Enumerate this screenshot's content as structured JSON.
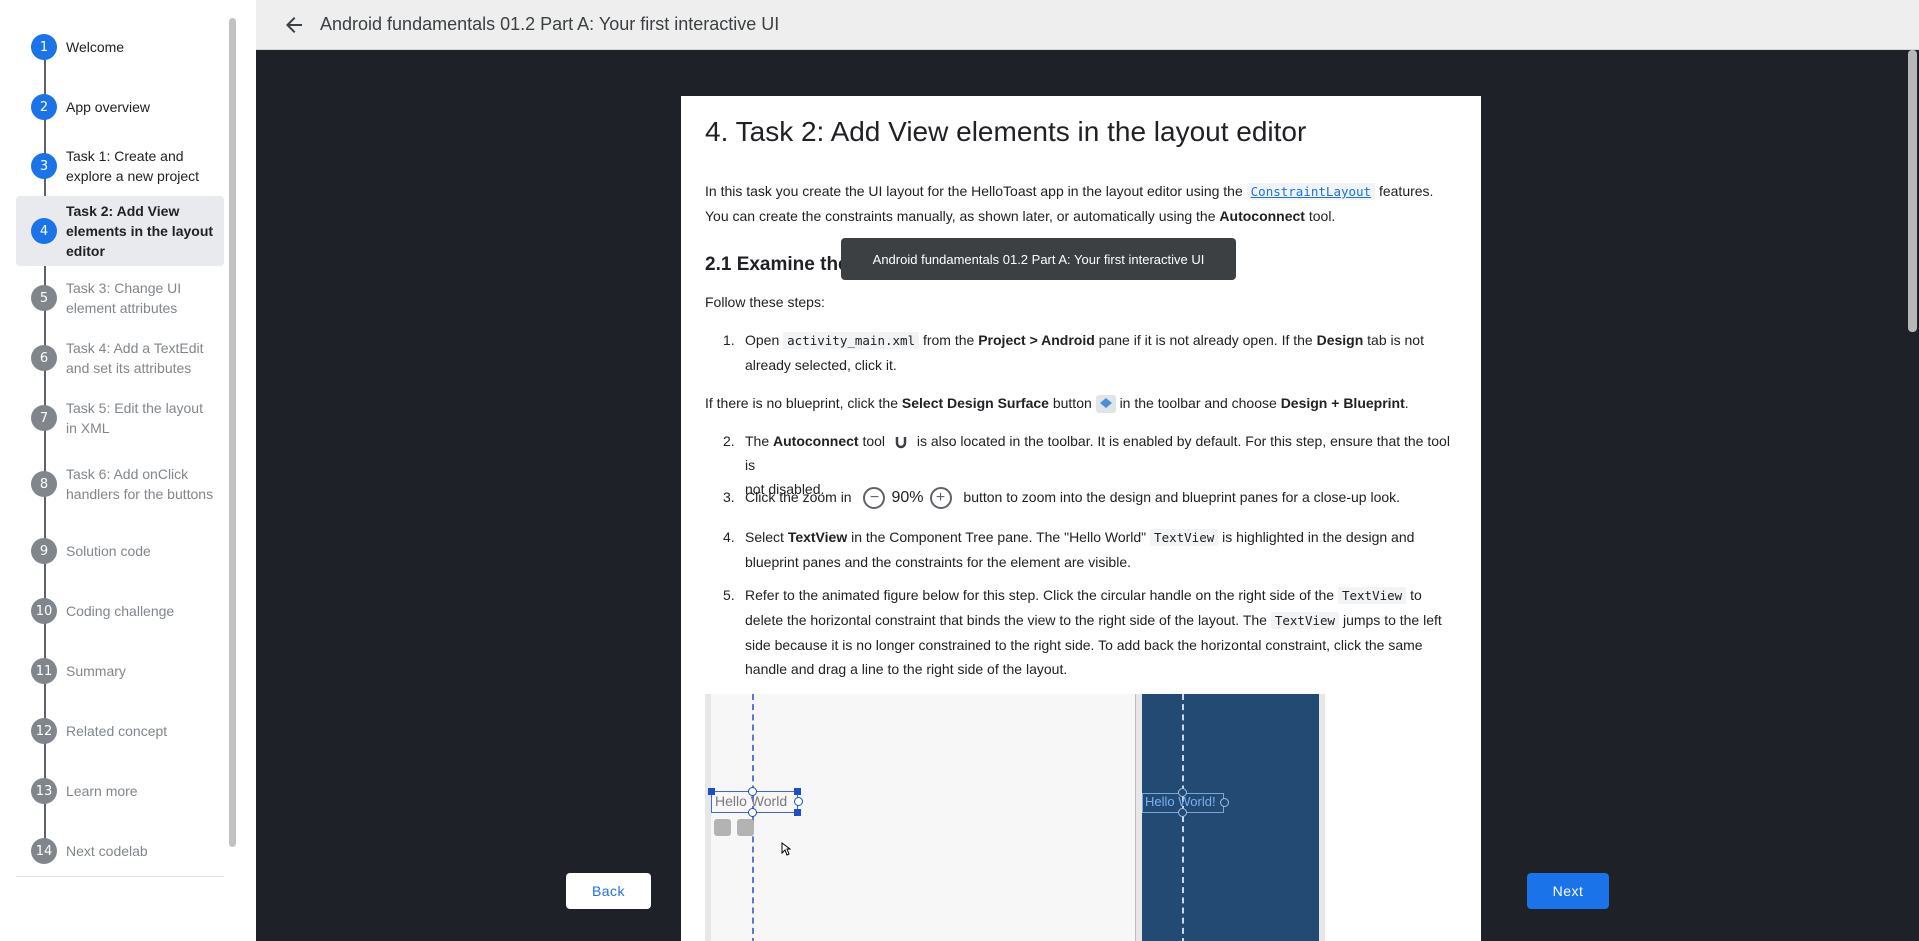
{
  "header": {
    "title": "Android fundamentals 01.2 Part A: Your first interactive UI"
  },
  "sidebar": {
    "steps": [
      {
        "num": "1",
        "label": "Welcome"
      },
      {
        "num": "2",
        "label": "App overview"
      },
      {
        "num": "3",
        "label": "Task 1: Create and explore a new project"
      },
      {
        "num": "4",
        "label": "Task 2: Add View elements in the layout editor"
      },
      {
        "num": "5",
        "label": "Task 3: Change UI element attributes"
      },
      {
        "num": "6",
        "label": "Task 4: Add a TextEdit and set its attributes"
      },
      {
        "num": "7",
        "label": "Task 5: Edit the layout in XML"
      },
      {
        "num": "8",
        "label": "Task 6: Add onClick handlers for the buttons"
      },
      {
        "num": "9",
        "label": "Solution code"
      },
      {
        "num": "10",
        "label": "Coding challenge"
      },
      {
        "num": "11",
        "label": "Summary"
      },
      {
        "num": "12",
        "label": "Related concept"
      },
      {
        "num": "13",
        "label": "Learn more"
      },
      {
        "num": "14",
        "label": "Next codelab"
      }
    ]
  },
  "content": {
    "heading": "4. Task 2: Add View elements in the layout editor",
    "intro": {
      "a": "In this task you create the UI layout for the HelloToast app in the layout editor using the",
      "link": "ConstraintLayout",
      "b": "features.",
      "c": "You can create the constraints manually, as shown later, or automatically using the",
      "bold": "Autoconnect",
      "d": "tool."
    },
    "subheading": "2.1 Examine the element constraints",
    "follow": "Follow these steps:",
    "step1": {
      "n": "1.",
      "a": "Open",
      "code": "activity_main.xml",
      "b": "from the",
      "bold1": "Project > Android",
      "c": "pane if it is not already open. If the",
      "bold2": "Design",
      "d": "tab is not",
      "e": "already selected, click it."
    },
    "blueprint_note": {
      "a": "If there is no blueprint, click the",
      "bold1": "Select Design Surface",
      "b": "button",
      "c": "in the toolbar and choose",
      "bold2": "Design + Blueprint",
      "d": "."
    },
    "step2": {
      "n": "2.",
      "a": "The",
      "bold": "Autoconnect",
      "b": "tool",
      "c": "is also located in the toolbar. It is enabled by default. For this step, ensure that the tool is",
      "d": "not disabled."
    },
    "step3": {
      "n": "3.",
      "a": "Click the zoom in",
      "zoom": "90%",
      "b": "button to zoom into the design and blueprint panes for a close-up look."
    },
    "step4": {
      "n": "4.",
      "a": "Select",
      "bold": "TextView",
      "b": "in the Component Tree pane. The \"Hello World\"",
      "code": "TextView",
      "c": "is highlighted in the design and",
      "d": "blueprint panes and the constraints for the element are visible."
    },
    "step5": {
      "n": "5.",
      "a": "Refer to the animated figure below for this step. Click the circular handle on the right side of the",
      "code1": "TextView",
      "b": "to",
      "c": "delete the horizontal constraint that binds the view to the right side of the layout. The",
      "code2": "TextView",
      "d": "jumps to the left",
      "e": "side because it is no longer constrained to the right side. To add back the horizontal constraint, click the same",
      "f": "handle and drag a line to the right side of the layout."
    },
    "figure": {
      "design_text": "Hello World",
      "blueprint_text": "Hello World!"
    }
  },
  "tooltip": "Android fundamentals 01.2 Part A: Your first interactive UI",
  "nav": {
    "back": "Back",
    "next": "Next"
  },
  "colors": {
    "accent": "#1a73e8",
    "main_bg": "#1e2128",
    "blueprint_bg": "#234a73"
  }
}
